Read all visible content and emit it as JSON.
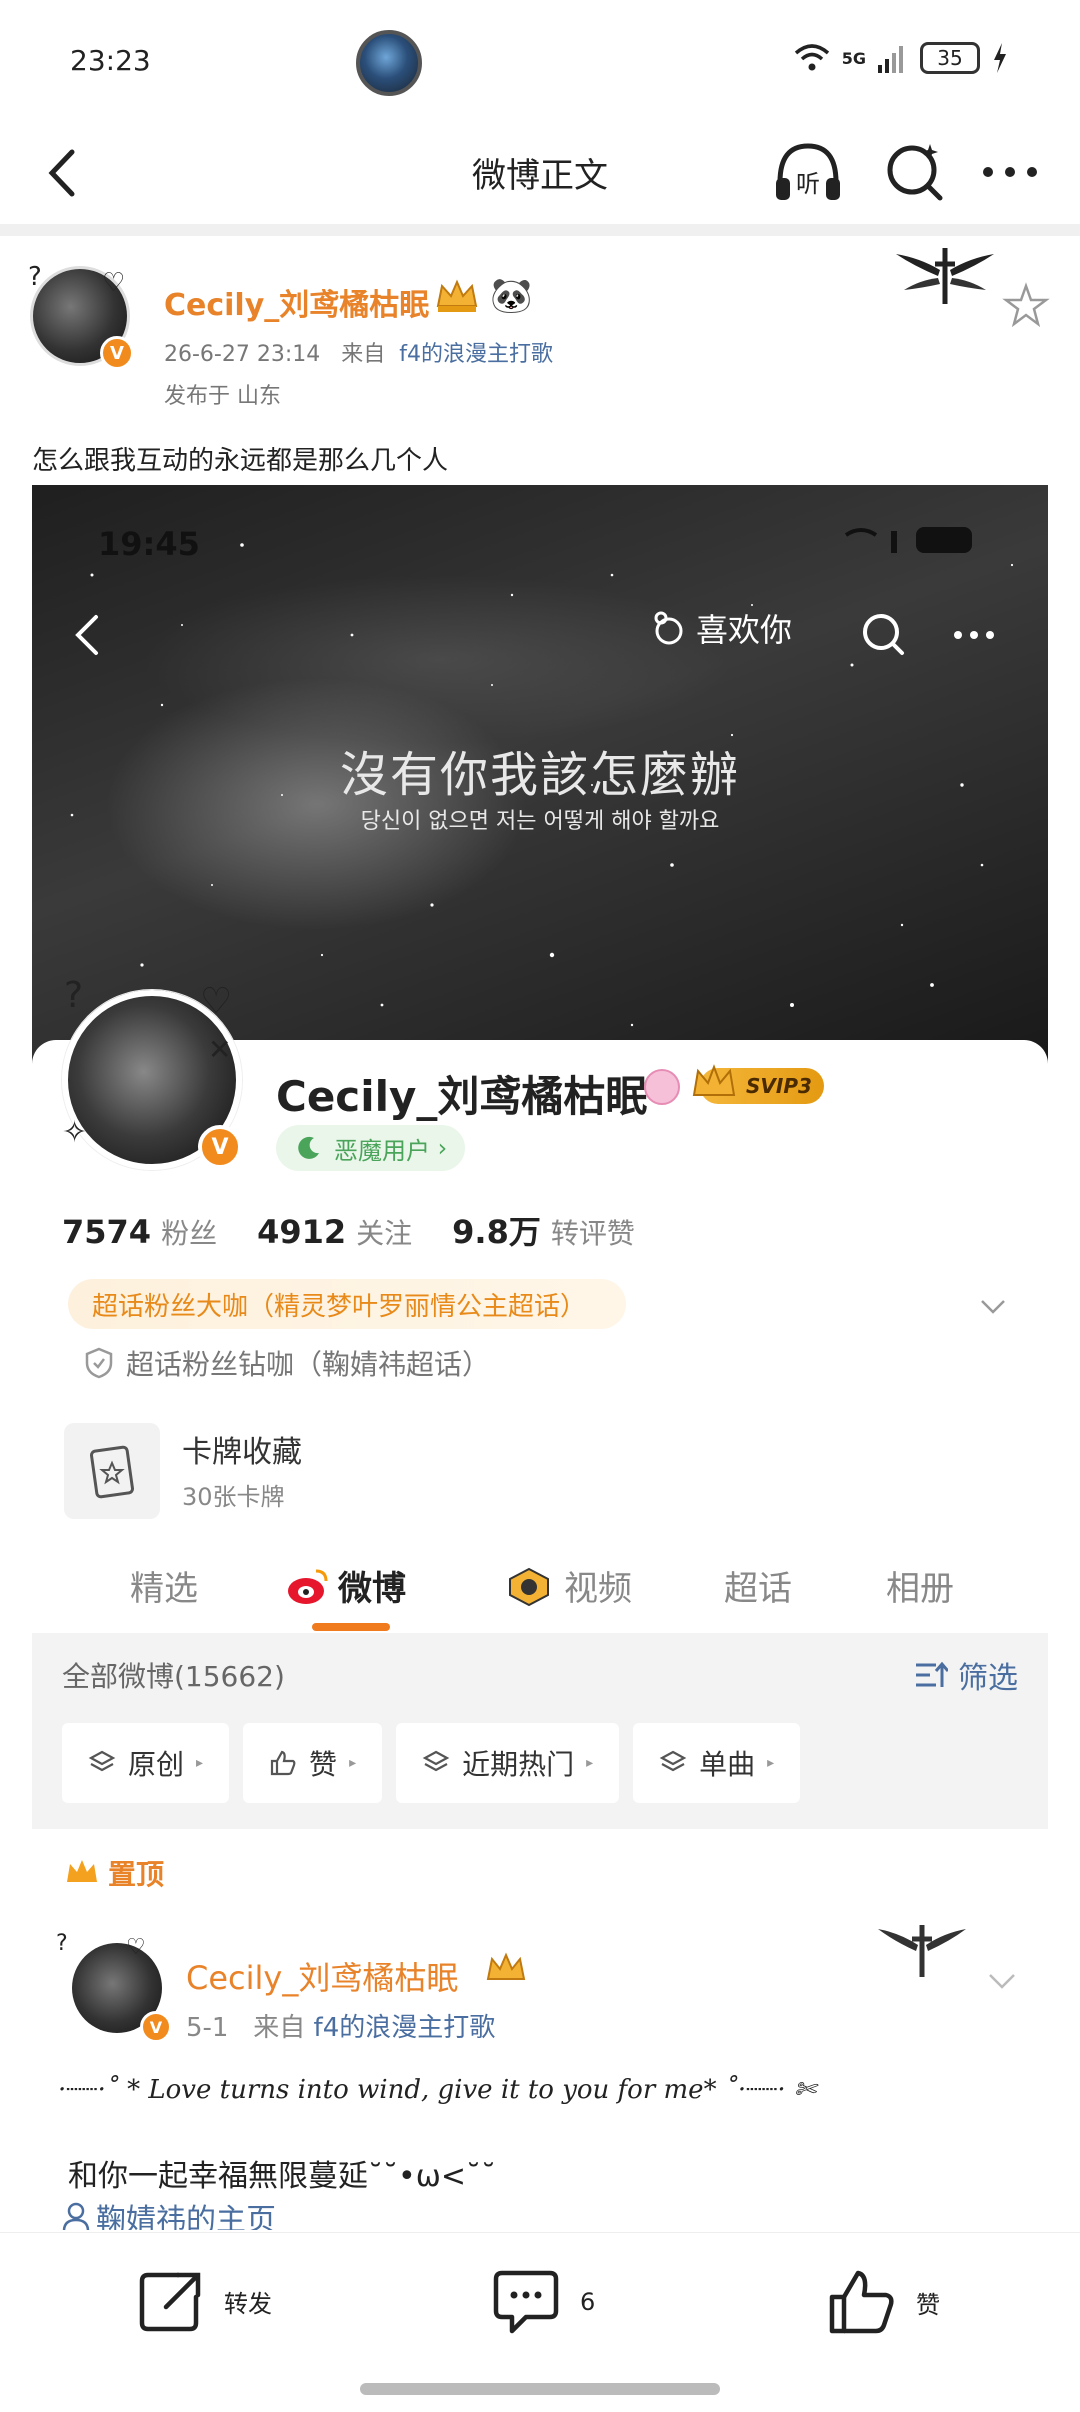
{
  "status": {
    "time": "23:23",
    "network": "5G",
    "battery": "35"
  },
  "nav": {
    "title": "微博正文",
    "listen_label": "听"
  },
  "post": {
    "author": "Cecily_刘鸢橘枯眠",
    "date": "26-6-27 23:14",
    "source_prefix": "来自",
    "source": "f4的浪漫主打歌",
    "location": "发布于 山东",
    "text": "怎么跟我互动的永远都是那么几个人"
  },
  "screenshot": {
    "time": "19:45",
    "like_label": "喜欢你",
    "lyric_cn": "沒有你我該怎麼辦",
    "lyric_kr": "당신이 없으면 저는 어떻게 해야 할까요",
    "profile": {
      "name": "Cecily_刘鸢橘枯眠",
      "svip": "SVIP3",
      "tag": "恶魔用户",
      "stats": [
        {
          "num": "7574",
          "label": "粉丝"
        },
        {
          "num": "4912",
          "label": "关注"
        },
        {
          "num": "9.8万",
          "label": "转评赞"
        }
      ],
      "fan_badge": "超话粉丝大咖（精灵梦叶罗丽情公主超话）",
      "fan_badge2": "超话粉丝钻咖（鞠婧祎超话）",
      "cards_title": "卡牌收藏",
      "cards_sub": "30张卡牌"
    },
    "tabs": [
      "精选",
      "微博",
      "视频",
      "超话",
      "相册"
    ],
    "active_tab": "微博",
    "filter": {
      "count_label": "全部微博(15662)",
      "filter_label": "筛选",
      "chips": [
        "原创",
        "赞",
        "近期热门",
        "单曲"
      ]
    },
    "pinned_label": "置顶",
    "post2": {
      "author": "Cecily_刘鸢橘枯眠",
      "date": "5-1",
      "source_prefix": "来自",
      "source": "f4的浪漫主打歌",
      "deco_line": "·┈┈·˚ * Love turns into wind, give it to you for me* ˚·┈┈· ✄",
      "text": "和你一起幸福無限蔓延˘˘•ω<˘˘",
      "link": "鞠婧祎的主页"
    }
  },
  "actions": {
    "repost": "转发",
    "comments": "6",
    "like": "赞"
  },
  "colors": {
    "accent": "#e8832a",
    "link": "#4a6ea0",
    "tab_underline": "#f07b1e"
  }
}
